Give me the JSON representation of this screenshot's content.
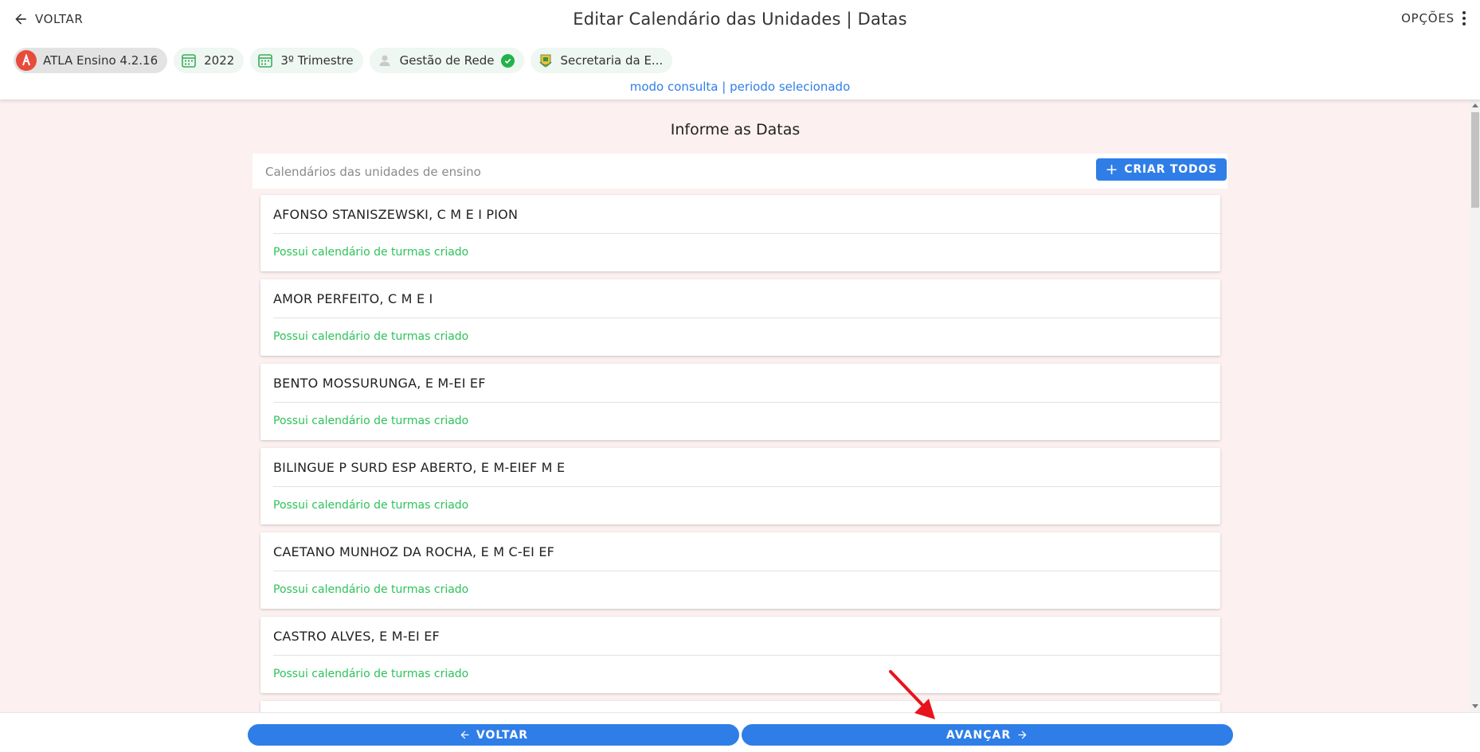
{
  "header": {
    "back_label": "VOLTAR",
    "title": "Editar Calendário das Unidades | Datas",
    "options_label": "OPÇÕES",
    "mode_text": "modo consulta | periodo selecionado"
  },
  "chips": [
    {
      "label": "ATLA Ensino 4.2.16",
      "icon": "atla-logo-icon"
    },
    {
      "label": "2022",
      "icon": "calendar-icon"
    },
    {
      "label": "3º Trimestre",
      "icon": "calendar-icon"
    },
    {
      "label": "Gestão de Rede",
      "icon": "user-icon",
      "verified": true
    },
    {
      "label": "Secretaria da E...",
      "icon": "crest-icon"
    }
  ],
  "main": {
    "section_title": "Informe as Datas",
    "list_label": "Calendários das unidades de ensino",
    "create_all_label": "CRIAR TODOS",
    "cards": [
      {
        "name": "AFONSO STANISZEWSKI, C M E I PION",
        "status": "Possui calendário de turmas criado"
      },
      {
        "name": "AMOR PERFEITO, C M E I",
        "status": "Possui calendário de turmas criado"
      },
      {
        "name": "BENTO MOSSURUNGA, E M-EI EF",
        "status": "Possui calendário de turmas criado"
      },
      {
        "name": "BILINGUE P SURD ESP ABERTO, E M-EIEF M E",
        "status": "Possui calendário de turmas criado"
      },
      {
        "name": "CAETANO MUNHOZ DA ROCHA, E M C-EI EF",
        "status": "Possui calendário de turmas criado"
      },
      {
        "name": "CASTRO ALVES, E M-EI EF",
        "status": "Possui calendário de turmas criado"
      }
    ]
  },
  "footer": {
    "back_label": "VOLTAR",
    "next_label": "AVANÇAR"
  },
  "colors": {
    "accent": "#2f7ee8",
    "status_green": "#2ec25a",
    "main_bg": "#fcf1f0",
    "annotation_red": "#e8141b"
  }
}
